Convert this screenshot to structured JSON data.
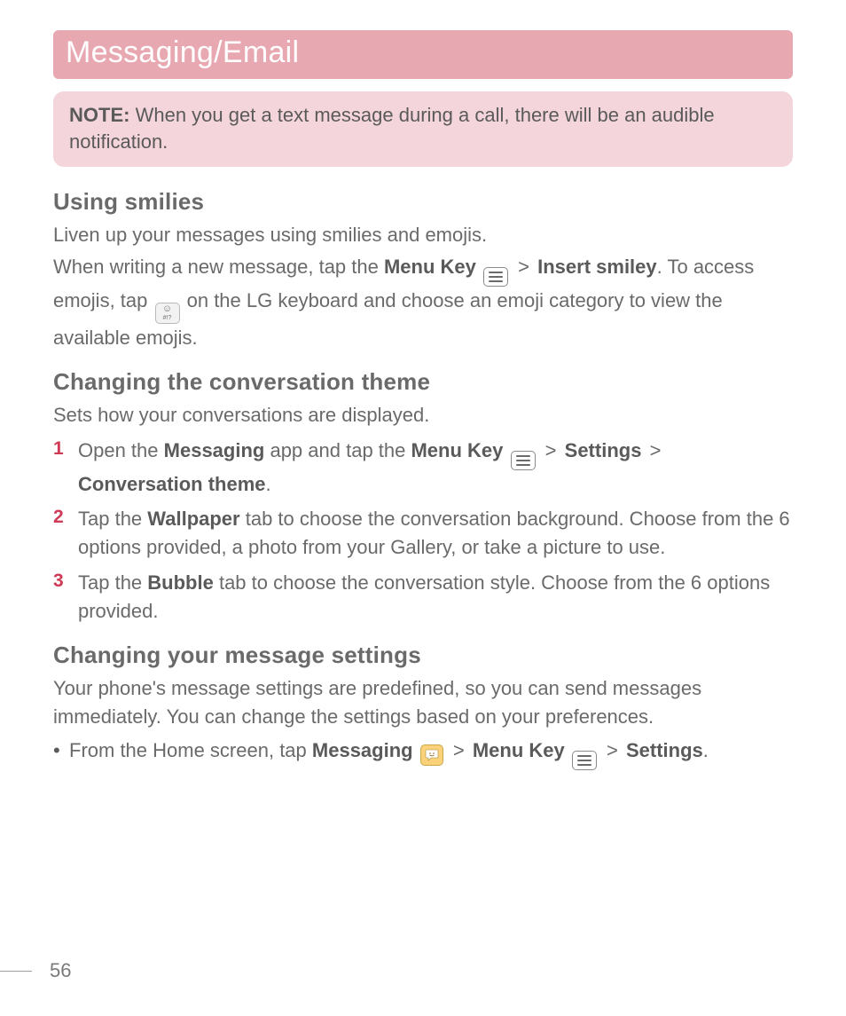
{
  "header": {
    "title": "Messaging/Email"
  },
  "note": {
    "label": "NOTE:",
    "text": "When you get a text message during a call, there will be an audible notification."
  },
  "sections": {
    "smilies": {
      "heading": "Using smilies",
      "intro1": "Liven up your messages using smilies and emojis.",
      "p2_a": "When writing a new message, tap the ",
      "p2_menu_key": "Menu Key",
      "p2_gt": ">",
      "p2_insert_smiley": "Insert smiley",
      "p2_b": ". To access emojis, tap ",
      "p2_c": " on the LG keyboard and choose an emoji category to view the available emojis."
    },
    "theme": {
      "heading": "Changing the conversation theme",
      "intro": "Sets how your conversations are displayed.",
      "steps": [
        {
          "num": "1",
          "a": "Open the ",
          "b_messaging": "Messaging",
          "c": " app and tap the ",
          "d_menu_key": "Menu Key",
          "gt1": ">",
          "e_settings": "Settings",
          "gt2": ">",
          "f_conv_theme": "Conversation theme",
          "g": "."
        },
        {
          "num": "2",
          "a": "Tap the ",
          "b_wallpaper": "Wallpaper",
          "c": " tab to choose the conversation background. Choose from the 6 options provided, a photo from your Gallery, or take a picture to use."
        },
        {
          "num": "3",
          "a": "Tap the ",
          "b_bubble": "Bubble",
          "c": " tab to choose the conversation style. Choose from the 6 options provided."
        }
      ]
    },
    "settings": {
      "heading": "Changing your message settings",
      "intro": "Your phone's message settings are predefined, so you can send messages immediately. You can change the settings based on your preferences.",
      "bullet": {
        "dot": "•",
        "a": "From the Home screen, tap ",
        "b_messaging": "Messaging",
        "gt1": ">",
        "c_menu_key": "Menu Key",
        "gt2": ">",
        "d_settings": "Settings",
        "e": "."
      }
    }
  },
  "icons": {
    "menu": "menu-key-icon",
    "emoji_key": "emoji-keyboard-icon",
    "messaging": "messaging-app-icon"
  },
  "footer": {
    "page": "56"
  }
}
